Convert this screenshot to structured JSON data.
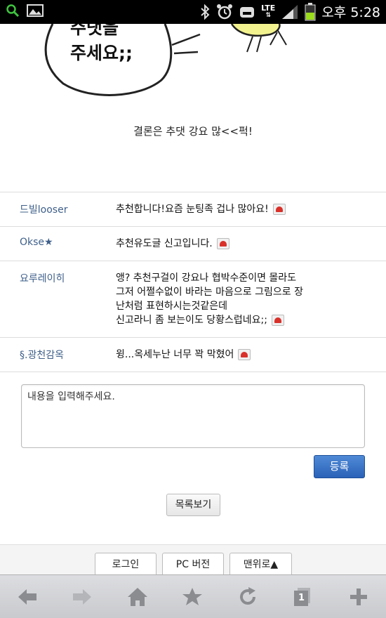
{
  "status_bar": {
    "time": "오후 5:28",
    "network": "LTE",
    "icons": [
      "search-icon",
      "image-icon",
      "bluetooth-icon",
      "alarm-icon",
      "silent-icon",
      "signal-icon",
      "battery-icon"
    ]
  },
  "comic": {
    "bubble_line1": "주댓을",
    "bubble_line2": "주세요;;"
  },
  "post": {
    "conclusion": "결론은 추댓 강요 많<<퍽!"
  },
  "comments": [
    {
      "author": "드빌looser",
      "text": "추천합니다!요즘 눈팅족 겁나 많아요!"
    },
    {
      "author": "Okse★",
      "text": "추천유도글 신고입니다."
    },
    {
      "author": "요루레이히",
      "text": "앵? 추천구걸이 강요나 협박수준이면 몰라도\n그저 어쩔수없이 바라는 마음으로 그림으로 장\n난처럼 표현하시는것같은데\n신고라니 좀 보는이도 당황스럽네요;;"
    },
    {
      "author": "§.광천감옥",
      "text": "윙...옥세누난 너무 꽉 막혔어"
    }
  ],
  "form": {
    "placeholder": "내용을 입력해주세요.",
    "submit_label": "등록",
    "list_label": "목록보기"
  },
  "footer": {
    "login": "로그인",
    "pc_version": "PC 버전",
    "to_top": "맨위로▲"
  },
  "browser_nav": {
    "tab_count": "1",
    "icons": [
      "back-icon",
      "forward-icon",
      "home-icon",
      "bookmark-star-icon",
      "refresh-icon",
      "tabs-icon",
      "add-icon"
    ]
  },
  "colors": {
    "author": "#3e5f8a",
    "submit_bg": "#2a62b8",
    "report": "#d9302a"
  }
}
